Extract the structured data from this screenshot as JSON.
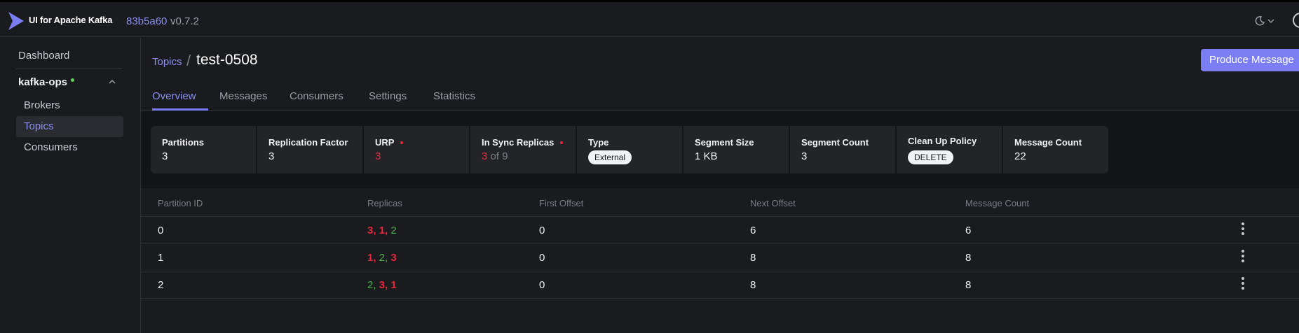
{
  "header": {
    "app_title": "UI for Apache Kafka",
    "version_hash": "83b5a60",
    "version": "v0.7.2"
  },
  "sidebar": {
    "dashboard": "Dashboard",
    "cluster": "kafka-ops",
    "items": [
      {
        "label": "Brokers",
        "active": false
      },
      {
        "label": "Topics",
        "active": true
      },
      {
        "label": "Consumers",
        "active": false
      }
    ]
  },
  "breadcrumb": {
    "parent": "Topics",
    "separator": "/",
    "title": "test-0508"
  },
  "actions": {
    "produce": "Produce Message"
  },
  "tabs": [
    "Overview",
    "Messages",
    "Consumers",
    "Settings",
    "Statistics"
  ],
  "active_tab": "Overview",
  "metrics": {
    "partitions": {
      "label": "Partitions",
      "value": "3"
    },
    "replication_factor": {
      "label": "Replication Factor",
      "value": "3"
    },
    "urp": {
      "label": "URP",
      "value": "3"
    },
    "in_sync": {
      "label": "In Sync Replicas",
      "value": "3",
      "suffix": "of 9"
    },
    "type": {
      "label": "Type",
      "value": "External"
    },
    "segment_size": {
      "label": "Segment Size",
      "value": "1 KB"
    },
    "segment_count": {
      "label": "Segment Count",
      "value": "3"
    },
    "cleanup_policy": {
      "label": "Clean Up Policy",
      "value": "DELETE"
    },
    "message_count": {
      "label": "Message Count",
      "value": "22"
    }
  },
  "table": {
    "headers": [
      "Partition ID",
      "Replicas",
      "First Offset",
      "Next Offset",
      "Message Count"
    ],
    "rows": [
      {
        "partition": "0",
        "replicas": [
          {
            "id": "3",
            "status": "red"
          },
          {
            "id": "1",
            "status": "red"
          },
          {
            "id": "2",
            "status": "green"
          }
        ],
        "first_offset": "0",
        "next_offset": "6",
        "message_count": "6"
      },
      {
        "partition": "1",
        "replicas": [
          {
            "id": "1",
            "status": "red"
          },
          {
            "id": "2",
            "status": "green"
          },
          {
            "id": "3",
            "status": "red"
          }
        ],
        "first_offset": "0",
        "next_offset": "8",
        "message_count": "8"
      },
      {
        "partition": "2",
        "replicas": [
          {
            "id": "2",
            "status": "green"
          },
          {
            "id": "3",
            "status": "red"
          },
          {
            "id": "1",
            "status": "red"
          }
        ],
        "first_offset": "0",
        "next_offset": "8",
        "message_count": "8"
      }
    ]
  },
  "colors": {
    "accent": "#7a7ef2",
    "link": "#8b8ff0",
    "error": "#e5283d",
    "success": "#4cae4c",
    "background": "#1a1b1e"
  },
  "icons": [
    "kafka-logo-icon",
    "moon-icon",
    "chevron-down-icon",
    "github-icon",
    "chevron-up-icon",
    "kebab-menu-icon"
  ]
}
